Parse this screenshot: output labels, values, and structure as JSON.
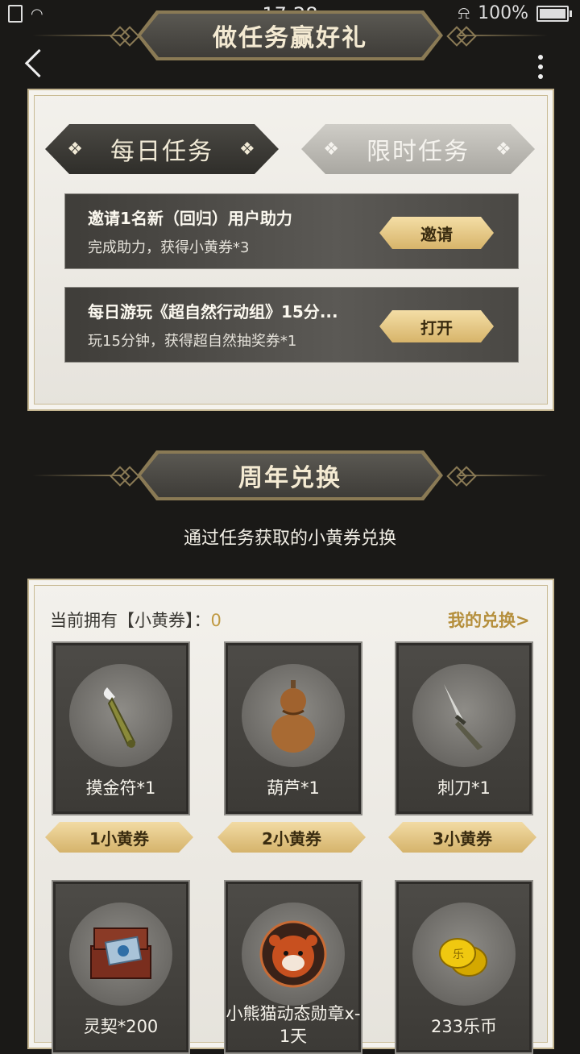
{
  "status": {
    "time": "17:28",
    "battery": "100%"
  },
  "header": {
    "title": "做任务赢好礼"
  },
  "tabs": [
    {
      "label": "每日任务",
      "active": true
    },
    {
      "label": "限时任务",
      "active": false
    }
  ],
  "tasks": [
    {
      "title": "邀请1名新（回归）用户助力",
      "desc": "完成助力，获得小黄券*3",
      "button": "邀请"
    },
    {
      "title": "每日游玩《超自然行动组》15分...",
      "desc": "玩15分钟，获得超自然抽奖券*1",
      "button": "打开"
    }
  ],
  "exchange": {
    "title": "周年兑换",
    "subtitle": "通过任务获取的小黄券兑换",
    "owned_label": "当前拥有【小黄券】：",
    "owned_value": "0",
    "my_exchange": "我的兑换>",
    "items": [
      {
        "name": "摸金符*1",
        "price": "1小黄券",
        "icon": "amulet-icon"
      },
      {
        "name": "葫芦*1",
        "price": "2小黄券",
        "icon": "gourd-icon"
      },
      {
        "name": "刺刀*1",
        "price": "3小黄券",
        "icon": "bayonet-icon"
      },
      {
        "name": "灵契*200",
        "icon": "chest-icon"
      },
      {
        "name": "小熊猫动态勋章x-1天",
        "icon": "red-panda-badge-icon"
      },
      {
        "name": "233乐币",
        "icon": "coins-icon"
      }
    ]
  },
  "colors": {
    "gold": "#d7b46a",
    "dark": "#1a1917",
    "panel": "#f3f1ec"
  }
}
